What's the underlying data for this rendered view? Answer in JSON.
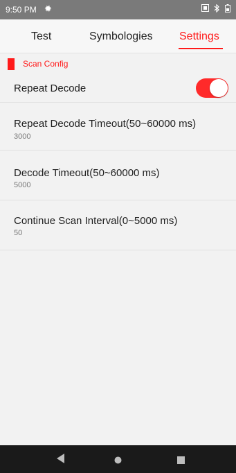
{
  "status_bar": {
    "time": "9:50 PM",
    "icons": [
      "settings-gear-icon",
      "screenshot-icon",
      "bluetooth-icon",
      "battery-icon"
    ]
  },
  "tabs": [
    {
      "label": "Test",
      "active": false
    },
    {
      "label": "Symbologies",
      "active": false
    },
    {
      "label": "Settings",
      "active": true
    }
  ],
  "section": {
    "title": "Scan Config"
  },
  "settings": [
    {
      "title": "Repeat Decode",
      "type": "toggle",
      "enabled": true
    },
    {
      "title": "Repeat Decode Timeout(50~60000 ms)",
      "value": "3000"
    },
    {
      "title": "Decode Timeout(50~60000 ms)",
      "value": "5000"
    },
    {
      "title": "Continue Scan Interval(0~5000 ms)",
      "value": "50"
    }
  ],
  "colors": {
    "accent": "#ff1a1a",
    "status_bar": "#7a7a7a",
    "nav_bar": "#1a1a1a",
    "background": "#f2f2f2"
  },
  "nav": [
    "back-icon",
    "home-icon",
    "recents-icon"
  ]
}
